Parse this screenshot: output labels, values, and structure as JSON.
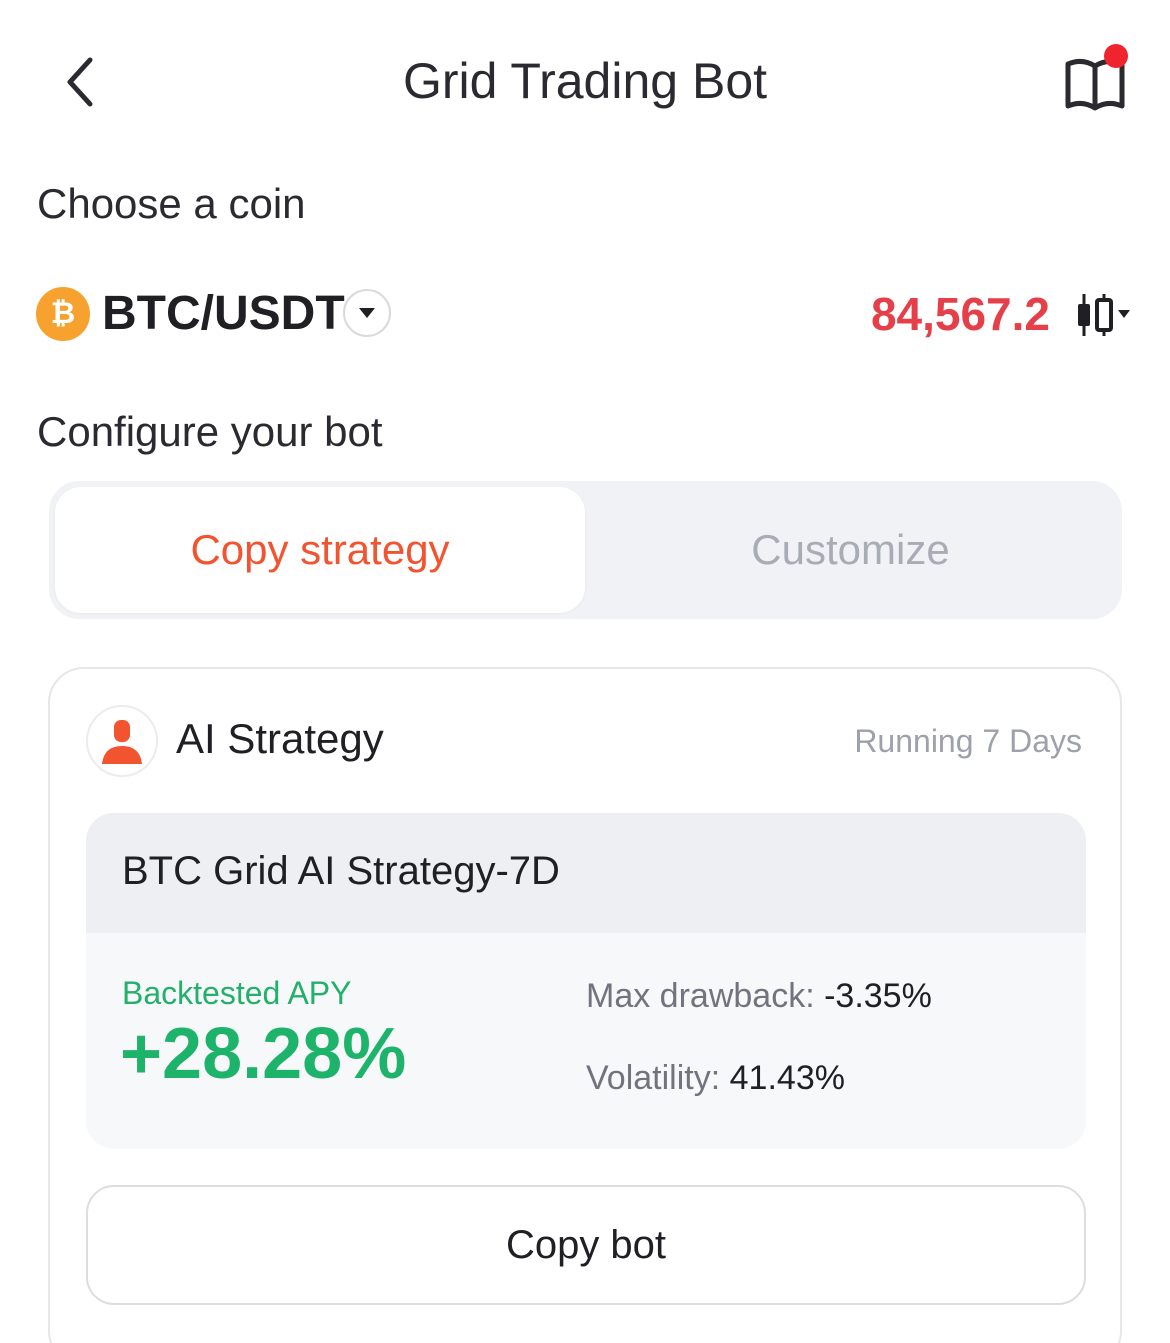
{
  "header": {
    "title": "Grid Trading Bot"
  },
  "coin_section": {
    "label": "Choose a coin",
    "pair": "BTC/USDT",
    "coin_symbol": "₿",
    "price": "84,567.2",
    "price_color": "#e5404a"
  },
  "config_section": {
    "label": "Configure your bot",
    "tabs": [
      {
        "label": "Copy strategy",
        "active": true
      },
      {
        "label": "Customize",
        "active": false
      }
    ],
    "accent": "#f25430"
  },
  "strategy": {
    "title": "AI Strategy",
    "status": "Running 7 Days",
    "name": "BTC Grid AI Strategy-7D",
    "apy_label": "Backtested APY",
    "apy_value": "+28.28%",
    "apy_color": "#1db36b",
    "max_drawback_label": "Max drawback:",
    "max_drawback_value": "-3.35%",
    "volatility_label": "Volatility:",
    "volatility_value": "41.43%",
    "button_label": "Copy bot"
  },
  "icons": [
    "back-arrow-icon",
    "guide-book-icon",
    "notification-dot",
    "btc-coin-icon",
    "chevron-down-icon",
    "candlestick-chart-icon",
    "ai-avatar-icon"
  ]
}
